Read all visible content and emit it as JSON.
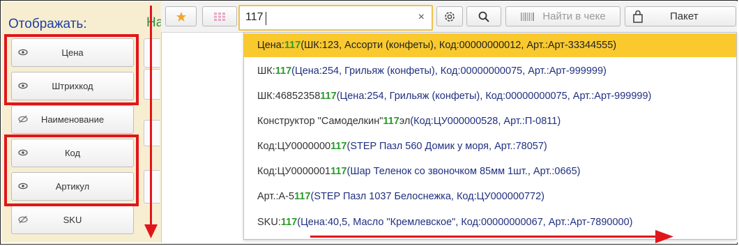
{
  "left_panel": {
    "title": "Отображать:",
    "buttons": [
      {
        "label": "Цена",
        "icon": "eye-icon"
      },
      {
        "label": "Штрихкод",
        "icon": "eye-icon"
      },
      {
        "label": "Наименование",
        "icon": "eye-slash-icon"
      },
      {
        "label": "Код",
        "icon": "eye-icon"
      },
      {
        "label": "Артикул",
        "icon": "eye-icon"
      },
      {
        "label": "SKU",
        "icon": "eye-slash-icon"
      }
    ]
  },
  "mid_panel": {
    "title_fragment": "На"
  },
  "toolbar": {
    "favorites_icon": "star-icon",
    "grid_icon": "grid-icon",
    "search_value": "117",
    "clear_symbol": "×",
    "settings_icon": "gear-icon",
    "search_button_icon": "magnifier-icon",
    "find_in_receipt_label": "Найти в чеке",
    "package_label": "Пакет"
  },
  "dropdown": {
    "rows": [
      {
        "key": "Цена:",
        "match": "117",
        "suffix": "",
        "details": " (ШК:123, Ассорти (конфеты), Код:00000000012, Арт.:Арт-33344555)",
        "selected": true
      },
      {
        "key": "ШК:",
        "match": "117",
        "suffix": "",
        "details": " (Цена:254, Грильяж (конфеты), Код:00000000075, Арт.:Арт-999999)",
        "selected": false
      },
      {
        "key": "ШК:46852358",
        "match": "117",
        "suffix": "",
        "details": " (Цена:254, Грильяж (конфеты), Код:00000000075, Арт.:Арт-999999)",
        "selected": false
      },
      {
        "key": "Конструктор \"Самоделкин\" ",
        "match": "117",
        "suffix": "эл",
        "details": " (Код:ЦУ000000528, Арт.:П-0811)",
        "selected": false
      },
      {
        "key": "Код:ЦУ0000000",
        "match": "117",
        "suffix": "",
        "details": " (STEP Пазл 560 Домик у моря, Арт.:78057)",
        "selected": false
      },
      {
        "key": "Код:ЦУ0000001",
        "match": "117",
        "suffix": "",
        "details": " (Шар Теленок со звоночком 85мм 1шт., Арт.:0665)",
        "selected": false
      },
      {
        "key": "Арт.:А-5",
        "match": "117",
        "suffix": "",
        "details": " (STEP Пазл 1037 Белоснежка, Код:ЦУ000000772)",
        "selected": false
      },
      {
        "key": "SKU:",
        "match": "117",
        "suffix": "",
        "details": " (Цена:40,5, Масло \"Кремлевское\", Код:00000000067, Арт.:Арт-7890000)",
        "selected": false
      }
    ]
  },
  "colors": {
    "annotation_red": "#e0161b",
    "highlight_yellow": "#f9c92e",
    "match_green": "#2b9a2b",
    "details_blue": "#203080",
    "panel_bg": "#f7eed2"
  }
}
